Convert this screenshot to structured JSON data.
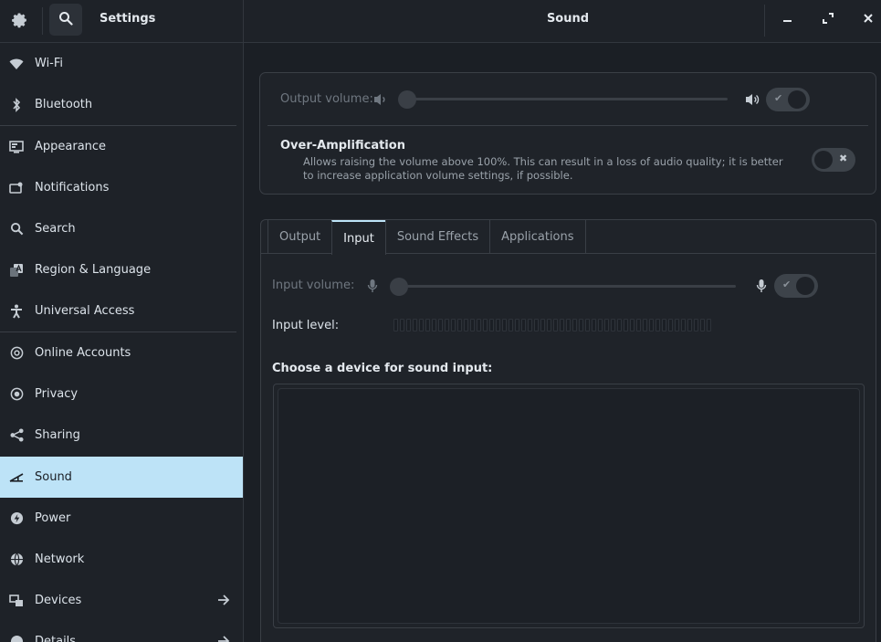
{
  "header": {
    "app_title": "Settings",
    "page_title": "Sound",
    "app_icon": "gear-icon",
    "search_icon": "search-icon",
    "window_buttons": [
      "minimize-icon",
      "maximize-icon",
      "close-icon"
    ]
  },
  "sidebar": {
    "items": [
      {
        "label": "Wi-Fi",
        "icon": "wifi-icon"
      },
      {
        "label": "Bluetooth",
        "icon": "bluetooth-icon"
      },
      {
        "label": "Appearance",
        "icon": "appearance-icon"
      },
      {
        "label": "Notifications",
        "icon": "notifications-icon"
      },
      {
        "label": "Search",
        "icon": "search-icon"
      },
      {
        "label": "Region & Language",
        "icon": "region-icon"
      },
      {
        "label": "Universal Access",
        "icon": "accessibility-icon"
      },
      {
        "label": "Online Accounts",
        "icon": "online-accounts-icon"
      },
      {
        "label": "Privacy",
        "icon": "privacy-icon"
      },
      {
        "label": "Sharing",
        "icon": "sharing-icon"
      },
      {
        "label": "Sound",
        "icon": "sound-icon",
        "active": true
      },
      {
        "label": "Power",
        "icon": "power-icon"
      },
      {
        "label": "Network",
        "icon": "network-icon"
      },
      {
        "label": "Devices",
        "icon": "devices-icon",
        "arrow": true
      },
      {
        "label": "Details",
        "icon": "details-icon",
        "arrow": true
      }
    ]
  },
  "output": {
    "volume_label": "Output volume:",
    "volume_level": 0,
    "toggle_on": true
  },
  "over_amplification": {
    "title": "Over-Amplification",
    "description": "Allows raising the volume above 100%. This can result in a loss of audio quality; it is better to increase application volume settings, if possible.",
    "toggle_on": false
  },
  "tabs": [
    {
      "label": "Output"
    },
    {
      "label": "Input",
      "active": true
    },
    {
      "label": "Sound Effects"
    },
    {
      "label": "Applications"
    }
  ],
  "input": {
    "volume_label": "Input volume:",
    "volume_level": 0,
    "toggle_on": true,
    "level_label": "Input level:",
    "level_value": 0,
    "device_heading": "Choose a device for sound input:"
  },
  "colors": {
    "accent": "#bde3f7",
    "background": "#1b1f25",
    "sidebar_bg": "#1e2228"
  }
}
